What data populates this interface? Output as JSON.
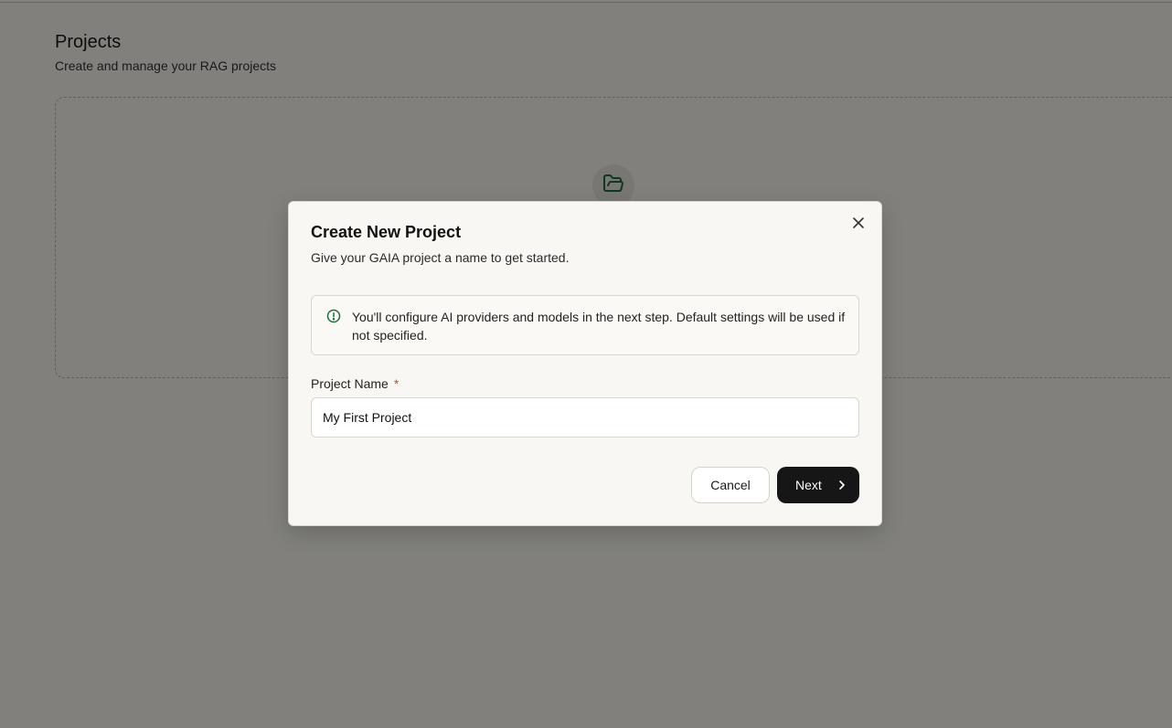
{
  "page": {
    "title": "Projects",
    "subtitle": "Create and manage your RAG projects"
  },
  "empty_state": {
    "icon": "folder-open-icon"
  },
  "dialog": {
    "title": "Create New Project",
    "description": "Give your GAIA project a name to get started.",
    "info_text": "You'll configure AI providers and models in the next step. Default settings will be used if not specified.",
    "field_label": "Project Name",
    "required_mark": "*",
    "project_name_value": "My First Project",
    "cancel_label": "Cancel",
    "next_label": "Next"
  },
  "colors": {
    "accent_green": "#1f6b3a",
    "primary_button": "#161616",
    "required": "#d9472b"
  }
}
